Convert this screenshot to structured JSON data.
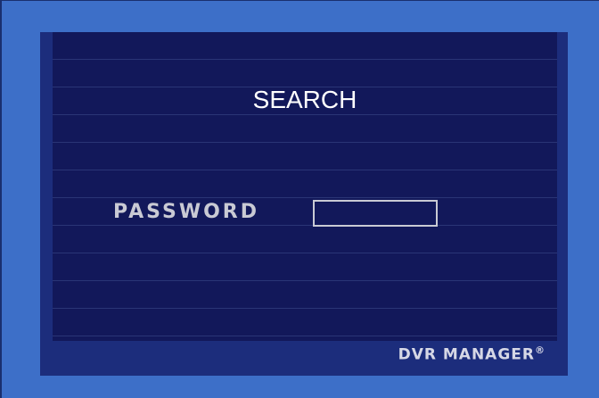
{
  "dialog": {
    "title": "SEARCH",
    "password_label": "PASSWORD",
    "password_value": "",
    "password_placeholder": ""
  },
  "branding": {
    "name": "DVR MANAGER",
    "mark": "®"
  },
  "colors": {
    "background": "#3d6fc8",
    "panel": "#1c2d7c",
    "inner": "#12185a",
    "text": "#ffffff",
    "label": "#c9cad4"
  }
}
